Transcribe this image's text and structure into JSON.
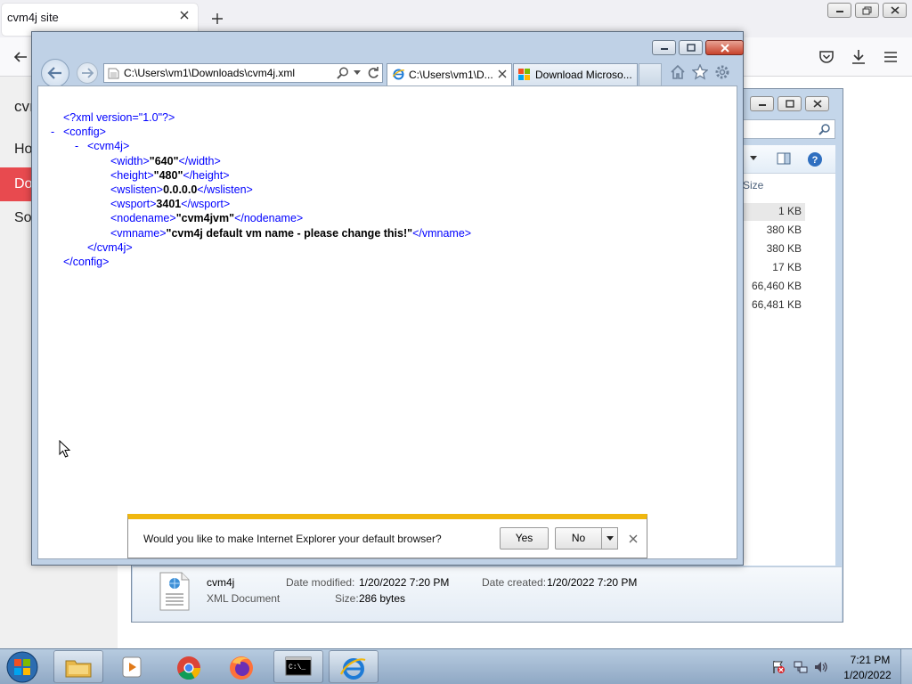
{
  "bg_browser": {
    "tab_title": "cvm4j site",
    "site_title": "cvı",
    "nav": {
      "home": "Ho",
      "downloads": "Do",
      "source": "So"
    }
  },
  "explorer": {
    "column_size": "Size",
    "sizes": [
      "1 KB",
      "380 KB",
      "380 KB",
      "17 KB",
      "66,460 KB",
      "66,481 KB"
    ],
    "details": {
      "name": "cvm4j",
      "type": "XML Document",
      "modified_label": "Date modified:",
      "modified_value": "1/20/2022 7:20 PM",
      "size_label": "Size:",
      "size_value": "286 bytes",
      "created_label": "Date created:",
      "created_value": "1/20/2022 7:20 PM"
    }
  },
  "ie": {
    "address": "C:\\Users\\vm1\\Downloads\\cvm4j.xml",
    "tab1": "C:\\Users\\vm1\\D...",
    "tab2": "Download Microso...",
    "xml": {
      "pi": "<?xml version=\"1.0\"?>",
      "config_open": "<config>",
      "cvm4j_open": "<cvm4j>",
      "width": {
        "open": "<width>",
        "val": "\"640\"",
        "close": "</width>"
      },
      "height": {
        "open": "<height>",
        "val": "\"480\"",
        "close": "</height>"
      },
      "wslisten": {
        "open": "<wslisten>",
        "val": "0.0.0.0",
        "close": "</wslisten>"
      },
      "wsport": {
        "open": "<wsport>",
        "val": "3401",
        "close": "</wsport>"
      },
      "nodename": {
        "open": "<nodename>",
        "val": "\"cvm4jvm\"",
        "close": "</nodename>"
      },
      "vmname": {
        "open": "<vmname>",
        "val": "\"cvm4j default vm name - please change this!\"",
        "close": "</vmname>"
      },
      "cvm4j_close": "</cvm4j>",
      "config_close": "</config>",
      "minus": "-"
    },
    "notification": {
      "text": "Would you like to make Internet Explorer your default browser?",
      "yes": "Yes",
      "no": "No"
    }
  },
  "taskbar": {
    "time": "7:21 PM",
    "date": "1/20/2022"
  },
  "colors": {
    "accent_red": "#e84a4f",
    "notif_bar": "#f0b70f",
    "xml_tag": "#990000",
    "xml_pi": "#0000ff"
  }
}
